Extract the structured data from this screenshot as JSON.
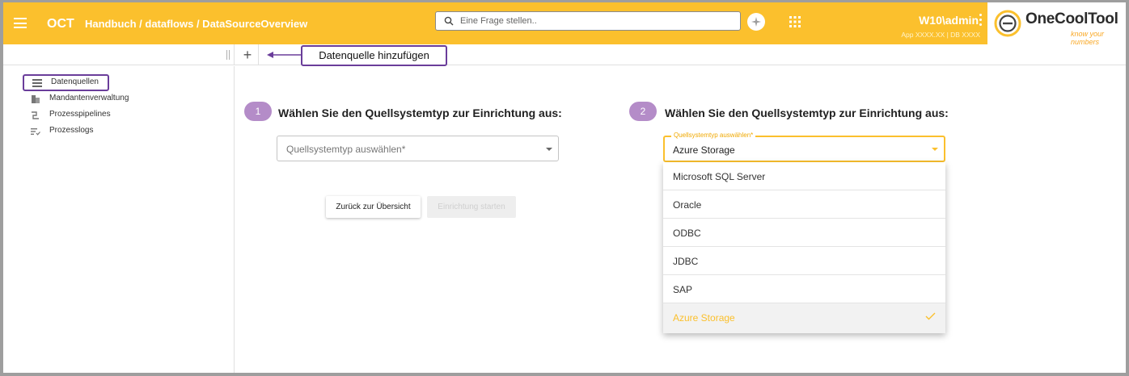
{
  "header": {
    "app_name": "OCT",
    "breadcrumb": "Handbuch / dataflows / DataSourceOverview",
    "search_placeholder": "Eine Frage stellen..",
    "user": "W10\\admin",
    "app_info": "App XXXX.XX | DB XXXX",
    "logo_text": "OneCoolTool",
    "logo_tagline": "know your numbers",
    "accent_color": "#fbc02d"
  },
  "toolbar": {
    "annotation": "Datenquelle hinzufügen"
  },
  "sidebar": {
    "items": [
      {
        "label": "Datenquellen",
        "icon": "list-icon"
      },
      {
        "label": "Mandantenverwaltung",
        "icon": "building-icon"
      },
      {
        "label": "Prozesspipelines",
        "icon": "pipeline-icon"
      },
      {
        "label": "Prozesslogs",
        "icon": "log-list-icon"
      }
    ]
  },
  "main": {
    "left": {
      "step": "1",
      "title": "Wählen Sie den Quellsystemtyp zur Einrichtung aus:",
      "select_placeholder": "Quellsystemtyp auswählen*",
      "back_button": "Zurück zur Übersicht",
      "start_button": "Einrichtung starten"
    },
    "right": {
      "step": "2",
      "title": "Wählen Sie den Quellsystemtyp zur Einrichtung aus:",
      "select_label": "Quellsystemtyp auswählen*",
      "select_value": "Azure Storage",
      "options": [
        "Microsoft SQL Server",
        "Oracle",
        "ODBC",
        "JDBC",
        "SAP",
        "Azure Storage"
      ],
      "selected_option": "Azure Storage"
    }
  }
}
